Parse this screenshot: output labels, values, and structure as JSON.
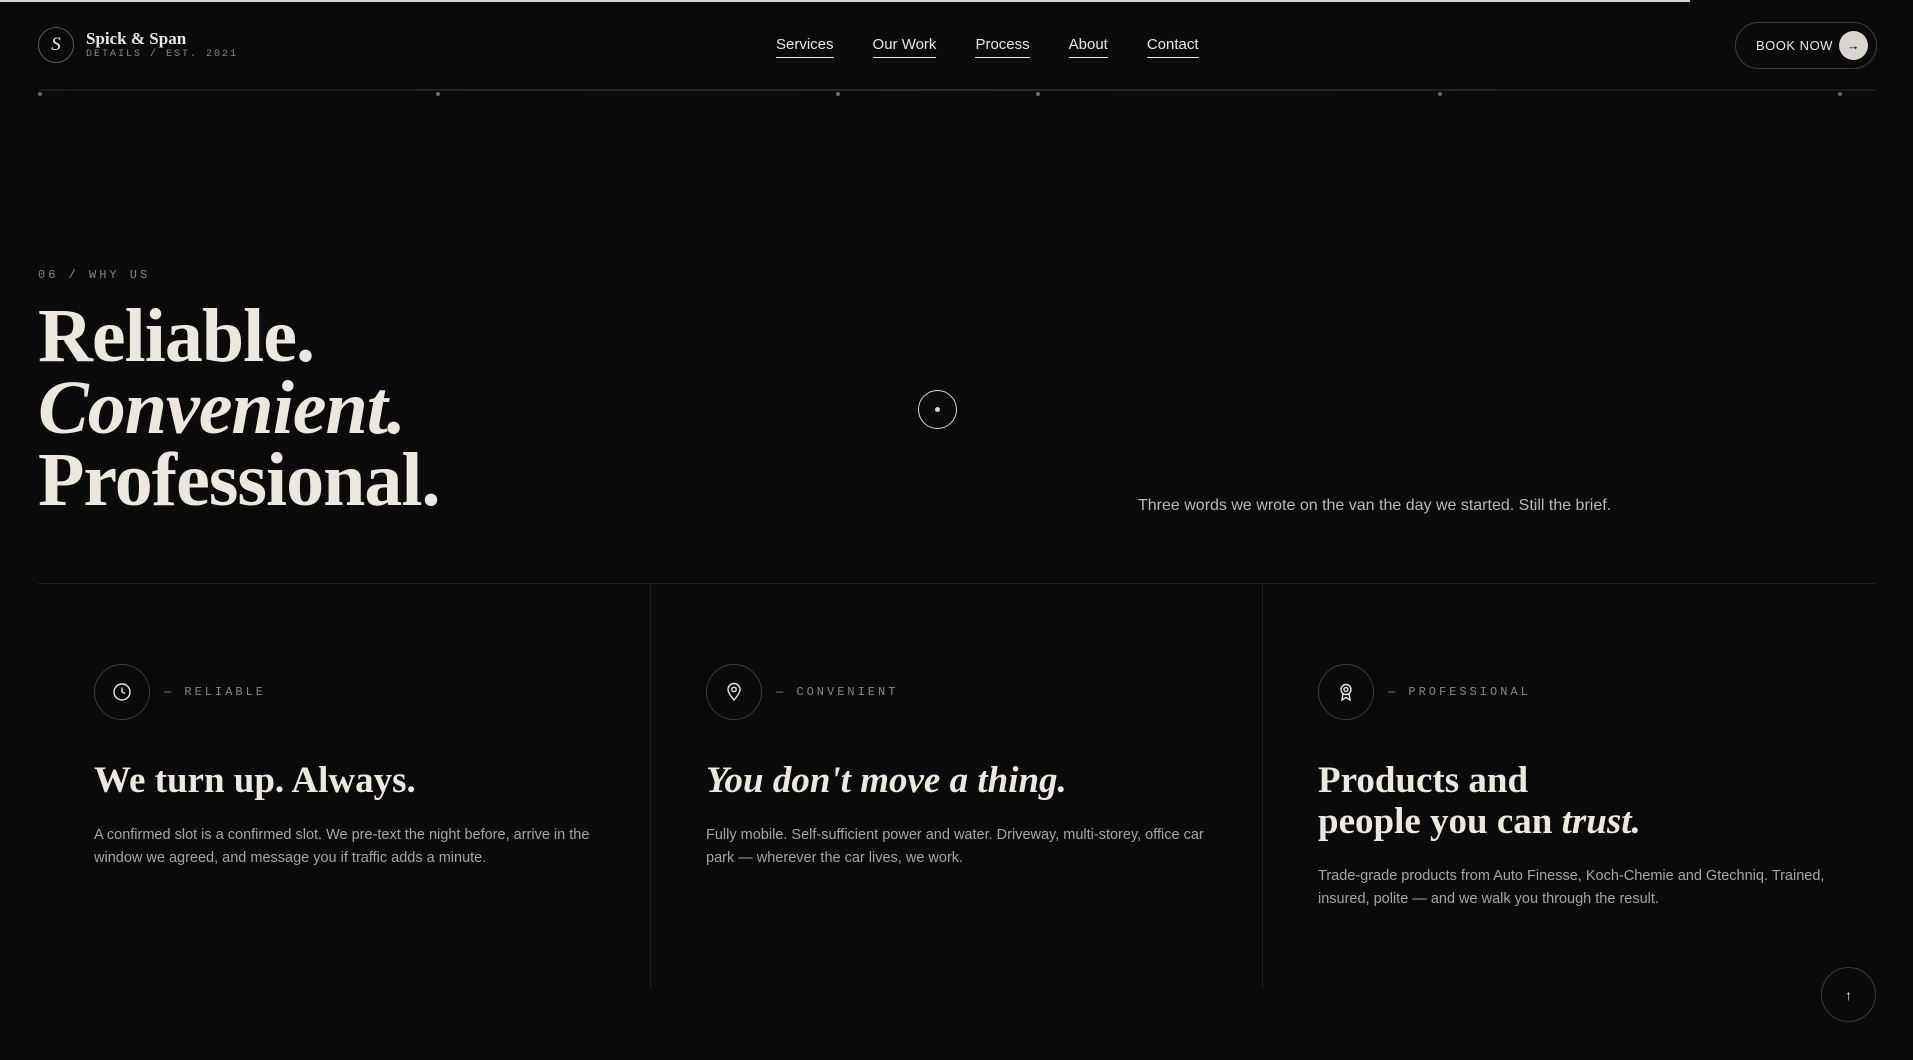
{
  "header": {
    "logo_mark": "S",
    "logo_name": "Spick & Span",
    "logo_sub": "DETAILS / EST. 2021",
    "nav": [
      "Services",
      "Our Work",
      "Process",
      "About",
      "Contact"
    ],
    "book_label": "BOOK NOW",
    "book_arrow": "→"
  },
  "hero": {
    "eyebrow": "06 / WHY US",
    "line1": "Reliable.",
    "line2": "Convenient.",
    "line3": "Professional.",
    "subtitle": "Three words we wrote on the van the day we started. Still the brief."
  },
  "columns": [
    {
      "icon": "clock-icon",
      "label": "— RELIABLE",
      "title": "We turn up. Always.",
      "body": "A confirmed slot is a confirmed slot. We pre-text the night before, arrive in the window we agreed, and message you if traffic adds a minute."
    },
    {
      "icon": "location-pin-icon",
      "label": "— CONVENIENT",
      "title": "You don't move a thing.",
      "body": "Fully mobile. Self-sufficient power and water. Driveway, multi-storey, office car park — wherever the car lives, we work."
    },
    {
      "icon": "award-ribbon-icon",
      "label": "— PROFESSIONAL",
      "title_line1": "Products and",
      "title_line2_plain": "people you can ",
      "title_line2_italic": "trust.",
      "body": "Trade-grade products from Auto Finesse, Koch-Chemie and Gtechniq. Trained, insured, polite — and we walk you through the result."
    }
  ],
  "scroll_top_arrow": "↑",
  "colors": {
    "background": "#0a0a0a",
    "text": "#ece8df",
    "muted": "#8a8780",
    "accent": "#d9d6cf"
  }
}
